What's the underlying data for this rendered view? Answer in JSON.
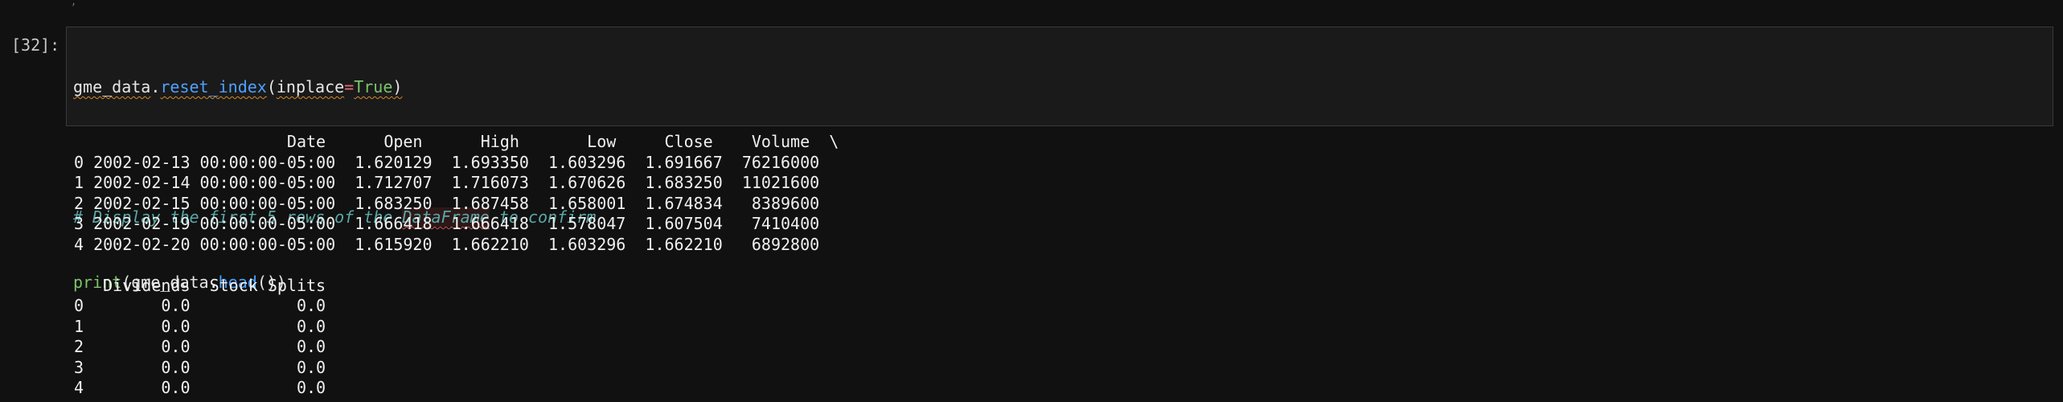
{
  "cell": {
    "prompt": "[32]:",
    "code": {
      "line1": {
        "obj": "gme_data",
        "dot": ".",
        "method": "reset_index",
        "open": "(",
        "param": "inplace",
        "eq": "=",
        "value": "True",
        "close": ")"
      },
      "line3": {
        "comment_a": "# Display the first 5 rows of the ",
        "comment_b": "DataFrame",
        "comment_c": " to confirm"
      },
      "line4": {
        "print": "print",
        "open": "(",
        "obj": "gme_data",
        "dot": ".",
        "method": "head",
        "close": "())"
      }
    }
  },
  "output": {
    "table1": {
      "header": "                      Date      Open      High       Low     Close    Volume  \\",
      "rows": [
        "0 2002-02-13 00:00:00-05:00  1.620129  1.693350  1.603296  1.691667  76216000",
        "1 2002-02-14 00:00:00-05:00  1.712707  1.716073  1.670626  1.683250  11021600",
        "2 2002-02-15 00:00:00-05:00  1.683250  1.687458  1.658001  1.674834   8389600",
        "3 2002-02-19 00:00:00-05:00  1.666418  1.666418  1.578047  1.607504   7410400",
        "4 2002-02-20 00:00:00-05:00  1.615920  1.662210  1.603296  1.662210   6892800"
      ]
    },
    "table2": {
      "header": "   Dividends  Stock Splits",
      "rows": [
        "0        0.0           0.0",
        "1        0.0           0.0",
        "2        0.0           0.0",
        "3        0.0           0.0",
        "4        0.0           0.0"
      ]
    }
  }
}
